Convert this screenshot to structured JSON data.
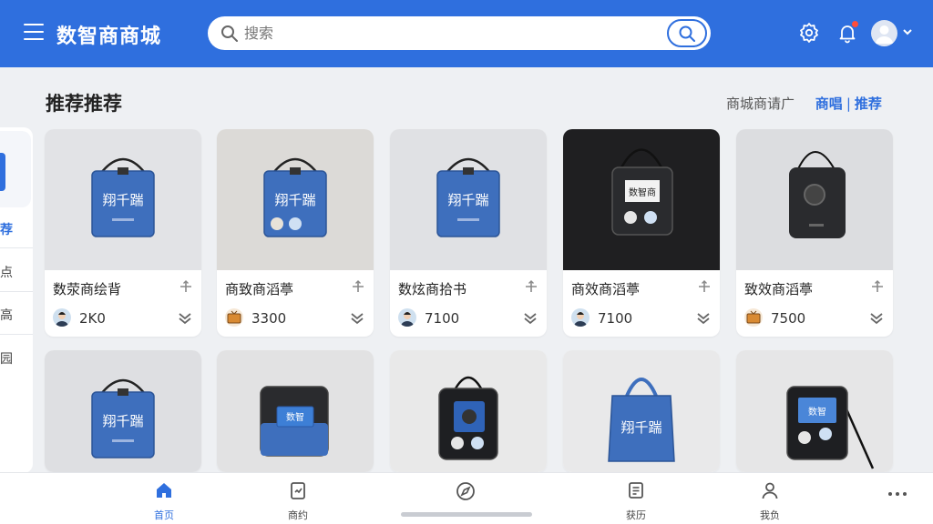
{
  "header": {
    "app_title": "数智商商城",
    "search_placeholder": "搜索"
  },
  "section": {
    "title": "推荐推荐",
    "link_plain": "商城商请广",
    "link_1": "商唱",
    "link_2": "推荐"
  },
  "sidebar": {
    "items": [
      {
        "label": "荐",
        "active": true
      },
      {
        "label": "点",
        "active": false
      },
      {
        "label": "高",
        "active": false
      },
      {
        "label": "园",
        "active": false
      }
    ]
  },
  "products": [
    {
      "name": "数荥商绘背",
      "price": "2K0",
      "seller": "person",
      "bag": "blue-square",
      "bag_text": "翔千踹"
    },
    {
      "name": "商致商滔葶",
      "price": "3300",
      "seller": "tv",
      "bag": "blue-badges",
      "bag_text": "翔千踹"
    },
    {
      "name": "数炫商拾书",
      "price": "7100",
      "seller": "person",
      "bag": "blue-square",
      "bag_text": "翔千踹"
    },
    {
      "name": "商效商滔葶",
      "price": "7100",
      "seller": "person",
      "bag": "dark-label",
      "bag_text": "数智商"
    },
    {
      "name": "致效商滔葶",
      "price": "7500",
      "seller": "tv",
      "bag": "dark-plain",
      "bag_text": ""
    },
    {
      "name": "",
      "price": "",
      "seller": "",
      "bag": "blue-square",
      "bag_text": "翔千踹"
    },
    {
      "name": "",
      "price": "",
      "seller": "",
      "bag": "black-blue",
      "bag_text": "数智"
    },
    {
      "name": "",
      "price": "",
      "seller": "",
      "bag": "black-badges",
      "bag_text": ""
    },
    {
      "name": "",
      "price": "",
      "seller": "",
      "bag": "blue-tote",
      "bag_text": "翔千踹"
    },
    {
      "name": "",
      "price": "",
      "seller": "",
      "bag": "black-screen",
      "bag_text": "数智"
    }
  ],
  "bottom_nav": [
    {
      "label": "首页",
      "icon": "home-icon",
      "active": true
    },
    {
      "label": "商约",
      "icon": "document-icon",
      "active": false
    },
    {
      "label": "",
      "icon": "compass-icon",
      "active": false
    },
    {
      "label": "获历",
      "icon": "list-icon",
      "active": false
    },
    {
      "label": "我负",
      "icon": "user-icon",
      "active": false
    },
    {
      "label": "",
      "icon": "more-icon",
      "active": false
    }
  ],
  "colors": {
    "brand": "#2f6fde",
    "notification_dot": "#ff4d3a",
    "page_bg": "#eef0f3"
  }
}
